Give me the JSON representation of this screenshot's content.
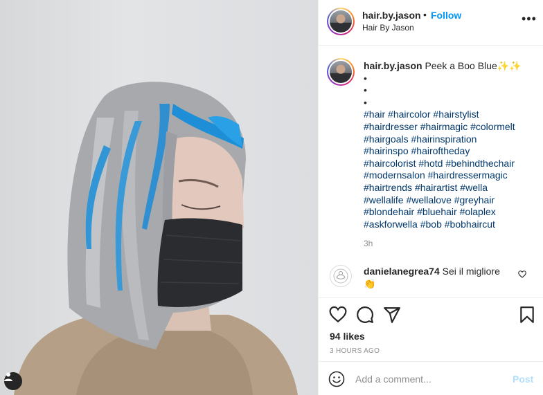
{
  "post": {
    "username": "hair.by.jason",
    "follow_separator": "•",
    "follow_label": "Follow",
    "location_line": "Hair By Jason",
    "more_label": "•••",
    "caption": {
      "username": "hair.by.jason",
      "text": "Peek a Boo Blue",
      "sparkles": "✨✨",
      "bullets": [
        "•",
        "•",
        "•"
      ],
      "hashtag_lines": [
        [
          "#hair",
          "#haircolor",
          "#hairstylist"
        ],
        [
          "#hairdresser",
          "#hairmagic",
          "#colormelt"
        ],
        [
          "#hairgoals",
          "#hairinspiration"
        ],
        [
          "#hairinspo",
          "#hairoftheday"
        ],
        [
          "#haircolorist",
          "#hotd",
          "#behindthechair"
        ],
        [
          "#modernsalon",
          "#hairdressermagic"
        ],
        [
          "#hairtrends",
          "#hairartist",
          "#wella"
        ],
        [
          "#wellalife",
          "#wellalove",
          "#greyhair"
        ],
        [
          "#blondehair",
          "#bluehair",
          "#olaplex"
        ],
        [
          "#askforwella",
          "#bob",
          "#bobhaircut"
        ]
      ],
      "time": "3h"
    },
    "comment": {
      "username": "danielanegrea74",
      "text": "Sei il migliore",
      "emoji": "👏"
    },
    "likes": "94 likes",
    "posted_ago": "3 HOURS AGO",
    "add_comment_placeholder": "Add a comment...",
    "post_label": "Post"
  },
  "icons": {
    "like": "heart-icon",
    "comment": "comment-icon",
    "share": "paper-plane-icon",
    "save": "bookmark-icon",
    "emoji": "smiley-icon",
    "tag": "user-tag-icon"
  },
  "colors": {
    "follow_blue": "#0095f6",
    "hashtag_blue": "#00376b",
    "muted": "#8e8e8e",
    "post_disabled": "#b2dffc"
  }
}
